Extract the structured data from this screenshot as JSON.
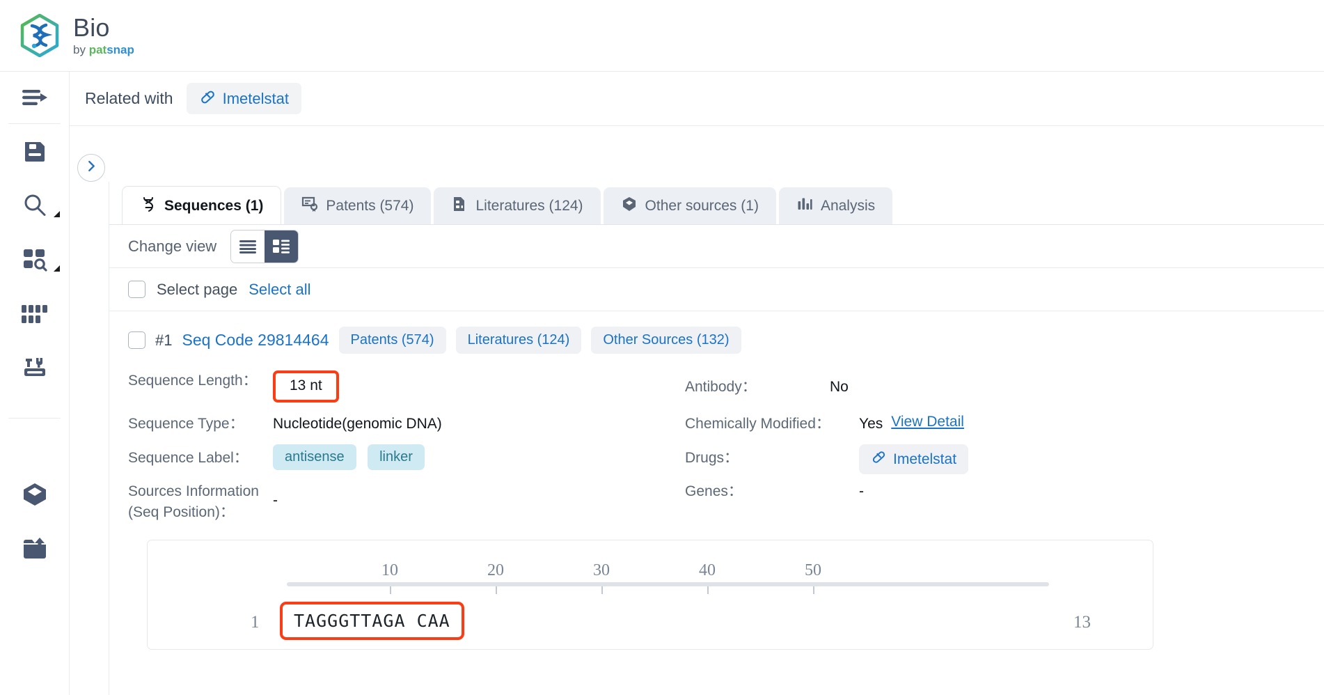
{
  "brand": {
    "title": "Bio",
    "by": "by ",
    "pat": "pat",
    "snap": "snap",
    "logo_icon": "dna-hexagon-logo-icon"
  },
  "rail": {
    "items": [
      {
        "name": "collapse-menu",
        "icon": "menu-arrow-icon",
        "caret": false
      },
      {
        "name": "sequence-library",
        "icon": "document-save-icon",
        "caret": false
      },
      {
        "name": "search",
        "icon": "search-icon",
        "caret": true
      },
      {
        "name": "batch-search",
        "icon": "grid-search-icon",
        "caret": true
      },
      {
        "name": "sequence-grid",
        "icon": "dots-grid-icon",
        "caret": false
      },
      {
        "name": "tools",
        "icon": "tools-icon",
        "caret": false
      },
      {
        "name": "workspace",
        "icon": "cube-icon",
        "caret": false
      },
      {
        "name": "upload",
        "icon": "upload-inbox-icon",
        "caret": false
      }
    ]
  },
  "header": {
    "related_label": "Related with",
    "related_chip": "Imetelstat",
    "related_chip_icon": "capsule-icon",
    "expand_icon": "chevron-right-icon"
  },
  "tabs": [
    {
      "label": "Sequences (1)",
      "icon": "dna-icon",
      "active": true
    },
    {
      "label": "Patents (574)",
      "icon": "patent-icon",
      "active": false
    },
    {
      "label": "Literatures (124)",
      "icon": "literature-icon",
      "active": false
    },
    {
      "label": "Other sources (1)",
      "icon": "hexagon-icon",
      "active": false
    },
    {
      "label": "Analysis",
      "icon": "bar-chart-icon",
      "active": false
    }
  ],
  "changeview": {
    "label": "Change view",
    "list_icon": "list-view-icon",
    "card_icon": "card-view-icon",
    "active": "card"
  },
  "selection": {
    "select_page": "Select page",
    "select_all": "Select all"
  },
  "record": {
    "index": "#1",
    "code": "Seq Code 29814464",
    "chips": [
      "Patents (574)",
      "Literatures (124)",
      "Other Sources (132)"
    ],
    "fields": {
      "sequence_length_label": "Sequence Length：",
      "sequence_length_value": "13 nt",
      "sequence_type_label": "Sequence Type：",
      "sequence_type_value": "Nucleotide(genomic DNA)",
      "sequence_label_label": "Sequence Label：",
      "sequence_label_tags": [
        "antisense",
        "linker"
      ],
      "sources_info_label_line1": "Sources Information",
      "sources_info_label_line2": "(Seq Position)：",
      "sources_info_value": "-",
      "antibody_label": "Antibody：",
      "antibody_value": "No",
      "chem_modified_label": "Chemically Modified：",
      "chem_modified_value": "Yes",
      "chem_modified_link": "View Detail",
      "drugs_label": "Drugs：",
      "drugs_value": "Imetelstat",
      "drugs_icon": "capsule-icon",
      "genes_label": "Genes：",
      "genes_value": "-"
    }
  },
  "sequence_viewer": {
    "ruler_ticks": [
      10,
      20,
      30,
      40,
      50
    ],
    "start_index": "1",
    "end_index": "13",
    "sequence": "TAGGGTTAGA CAA"
  },
  "colors": {
    "accent_blue": "#1a73c8",
    "highlight_red": "#fa3d14",
    "tag_bg": "#cfeaf2",
    "chip_bg": "#eff1f4",
    "rail_icon": "#4a5770"
  }
}
